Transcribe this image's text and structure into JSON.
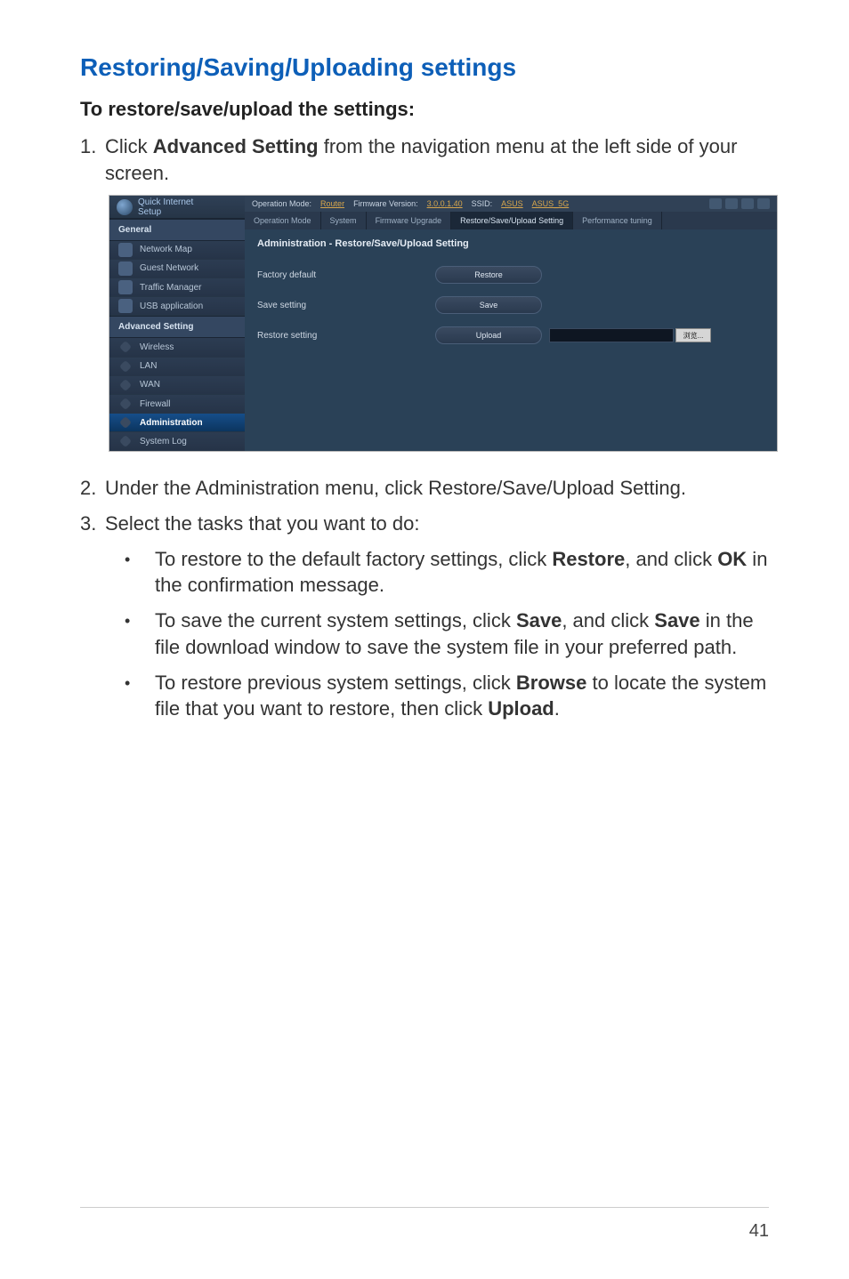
{
  "title": "Restoring/Saving/Uploading settings",
  "subtitle": "To restore/save/upload the settings:",
  "step1_num": "1.",
  "step1_a": "Click ",
  "step1_b": "Advanced Setting",
  "step1_c": " from the navigation menu at the left side of your screen.",
  "step2_num": "2.",
  "step2": "Under the Administration menu, click Restore/Save/Upload Setting.",
  "step3_num": "3.",
  "step3": "Select the tasks that you want to do:",
  "bullet_dot": "•",
  "b1_a": "To restore to the default factory settings, click ",
  "b1_b": "Restore",
  "b1_c": ", and click ",
  "b1_d": "OK",
  "b1_e": " in the confirmation message.",
  "b2_a": "To save the current system settings, click ",
  "b2_b": "Save",
  "b2_c": ", and click ",
  "b2_d": "Save",
  "b2_e": " in the file download window to save the system file in your preferred path.",
  "b3_a": "To restore previous system settings, click ",
  "b3_b": "Browse",
  "b3_c": " to locate the system file that you want to restore, then click ",
  "b3_d": "Upload",
  "b3_e": ".",
  "router": {
    "qis_a": "Quick Internet",
    "qis_b": "Setup",
    "section_general": "General",
    "nav_network_map": "Network Map",
    "nav_guest": "Guest Network",
    "nav_traffic": "Traffic Manager",
    "nav_usb": "USB application",
    "section_advanced": "Advanced Setting",
    "nav_wireless": "Wireless",
    "nav_lan": "LAN",
    "nav_wan": "WAN",
    "nav_firewall": "Firewall",
    "nav_admin": "Administration",
    "nav_syslog": "System Log",
    "info_opmode_l": "Operation Mode: ",
    "info_opmode_v": "Router",
    "info_fw_l": "Firmware Version: ",
    "info_fw_v": "3.0.0.1.40",
    "info_ssid_l": "SSID: ",
    "info_ssid_v1": "ASUS",
    "info_ssid_v2": "ASUS_5G",
    "tab_opmode": "Operation Mode",
    "tab_system": "System",
    "tab_fw": "Firmware Upgrade",
    "tab_rsu": "Restore/Save/Upload Setting",
    "tab_perf": "Performance tuning",
    "panel_title": "Administration - Restore/Save/Upload Setting",
    "row1_label": "Factory default",
    "row1_btn": "Restore",
    "row2_label": "Save setting",
    "row2_btn": "Save",
    "row3_label": "Restore setting",
    "row3_btn": "Upload",
    "browse": "浏览..."
  },
  "page_num": "41"
}
